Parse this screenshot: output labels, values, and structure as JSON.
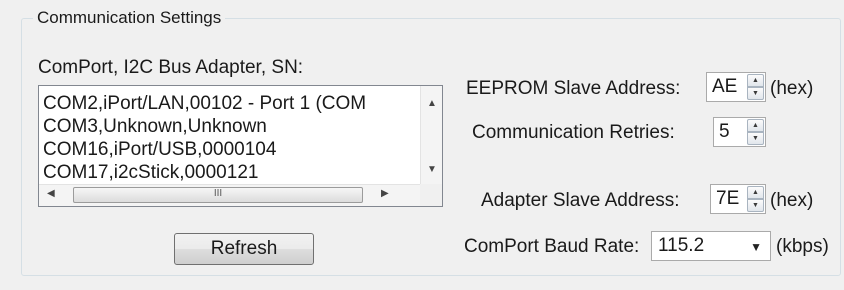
{
  "group_title": "Communication Settings",
  "comport_label": "ComPort, I2C Bus Adapter, SN:",
  "comport_list": [
    "COM2,iPort/LAN,00102 - Port 1 (COM",
    "COM3,Unknown,Unknown",
    "COM16,iPort/USB,0000104",
    "COM17,i2cStick,0000121"
  ],
  "refresh_label": "Refresh",
  "eeprom": {
    "label": "EEPROM Slave Address:",
    "value": "AE",
    "unit": "(hex)"
  },
  "retries": {
    "label": "Communication Retries:",
    "value": "5"
  },
  "adapter": {
    "label": "Adapter Slave Address:",
    "value": "7E",
    "unit": "(hex)"
  },
  "baud": {
    "label": "ComPort Baud Rate:",
    "value": "115.2",
    "unit": "(kbps)"
  },
  "icons": {
    "scroll_up": "▲",
    "scroll_down": "▼",
    "scroll_left": "◀",
    "scroll_right": "▶",
    "grip": "III",
    "spin_up": "▲",
    "spin_down": "▼",
    "dropdown": "▼"
  }
}
